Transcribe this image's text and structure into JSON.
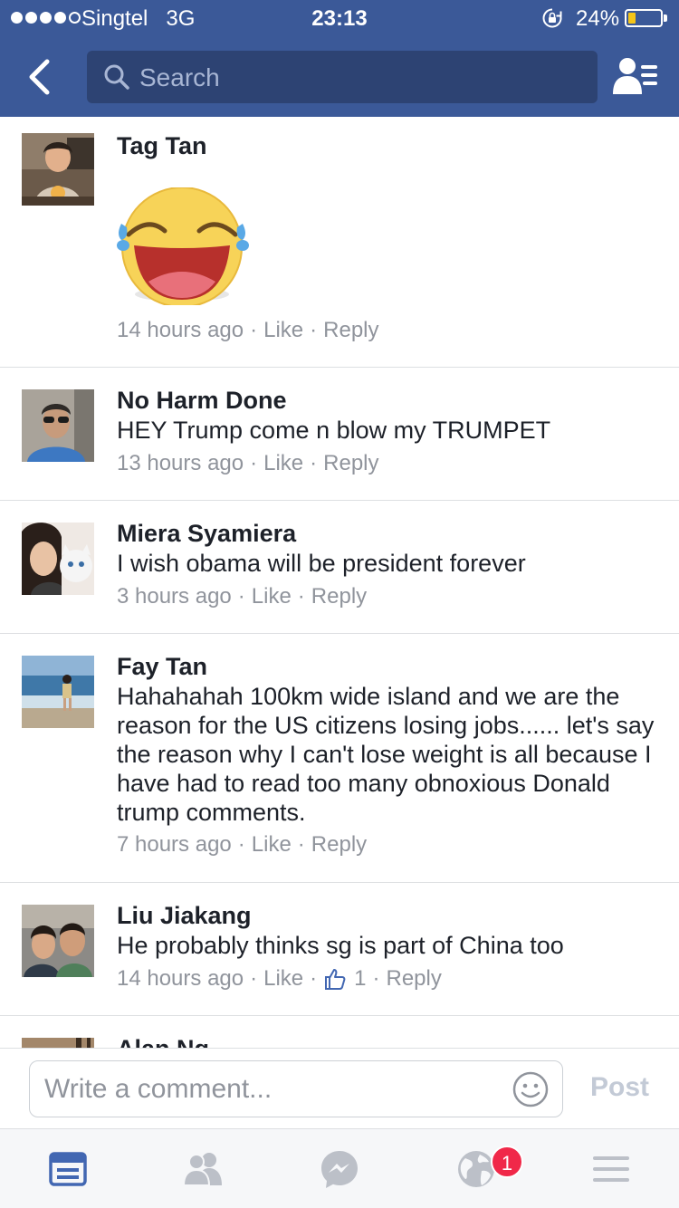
{
  "status_bar": {
    "carrier": "Singtel",
    "network": "3G",
    "time": "23:13",
    "battery_percent": "24%",
    "battery_level": 0.24,
    "signal_bars": 4
  },
  "nav": {
    "search_placeholder": "Search"
  },
  "comments": [
    {
      "author": "Tag Tan",
      "text": "",
      "sticker": "laughing-tears-sticker",
      "time": "14 hours ago",
      "like": "Like",
      "reply": "Reply",
      "sep": "·"
    },
    {
      "author": "No Harm Done",
      "text": "HEY Trump come n blow my TRUMPET",
      "time": "13 hours ago",
      "like": "Like",
      "reply": "Reply",
      "sep": "·"
    },
    {
      "author": "Miera Syamiera",
      "text": "I wish obama will be president forever",
      "time": "3 hours ago",
      "like": "Like",
      "reply": "Reply",
      "sep": "·"
    },
    {
      "author": "Fay Tan",
      "text": "Hahahahah 100km wide island  and we are the reason for the US citizens losing jobs...... let's say the reason why I can't lose weight is all because I have had to read too many obnoxious Donald trump comments.",
      "time": "7 hours ago",
      "like": "Like",
      "reply": "Reply",
      "sep": "·"
    },
    {
      "author": "Liu Jiakang",
      "text": "He probably thinks sg is part of China too",
      "time": "14 hours ago",
      "like": "Like",
      "likes_count": "1",
      "reply": "Reply",
      "sep": "·"
    },
    {
      "author": "Alan Ng"
    }
  ],
  "composer": {
    "placeholder": "Write a comment...",
    "post_label": "Post"
  },
  "tabs": {
    "notifications_badge": "1"
  },
  "colors": {
    "brand_blue": "#3b5998",
    "active_tab": "#4267b2",
    "muted_text": "#90949c",
    "badge_red": "#f02849"
  }
}
